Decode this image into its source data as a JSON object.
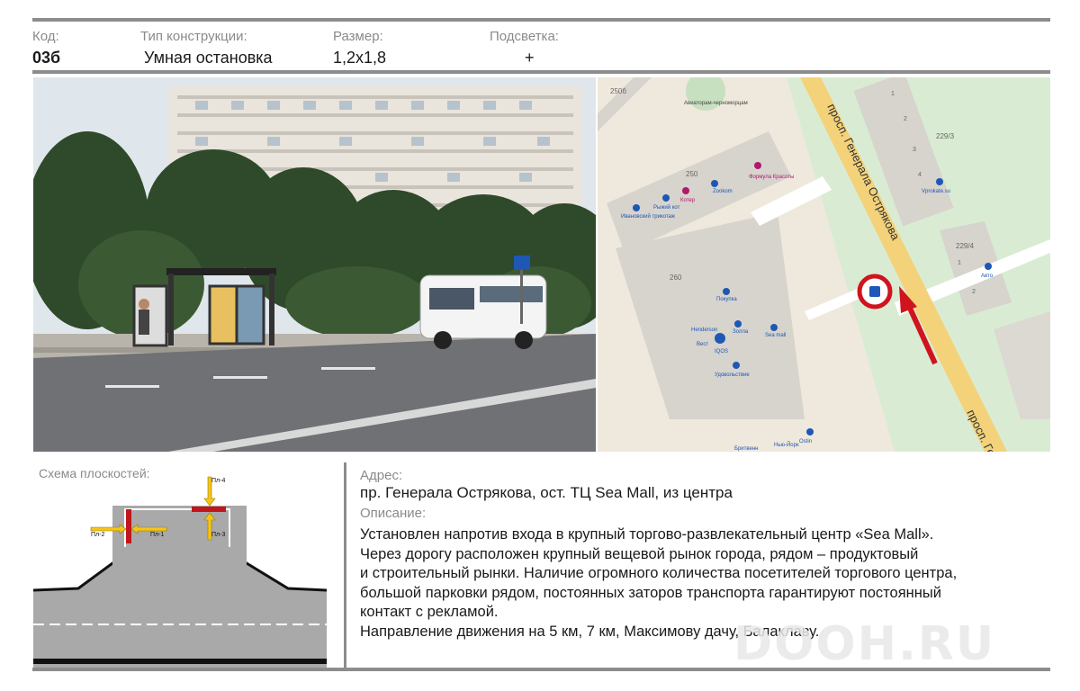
{
  "header": {
    "code_label": "Код:",
    "code_value": "03б",
    "type_label": "Тип конструкции:",
    "type_value": "Умная остановка",
    "size_label": "Размер:",
    "size_value": "1,2х1,8",
    "light_label": "Подсветка:",
    "light_value": "+"
  },
  "map": {
    "street_label": "просп. Генерала Острякова",
    "street_label_short": "просп. Гене",
    "numbers": [
      "250б",
      "250",
      "260",
      "229/3",
      "229/4",
      "1",
      "2",
      "3",
      "4",
      "1",
      "2"
    ],
    "places": [
      "Авиаторам-черноморцам",
      "Формула Красоты",
      "Zookom",
      "Котер",
      "Рыжий кот",
      "Ивановский трикотаж",
      "Vprokate.su",
      "Авто",
      "Покупка",
      "Henderson",
      "Золла",
      "Sea mall",
      "Вест",
      "IQOS",
      "Удовольствие",
      "Бритвенн",
      "Нью-Йорк",
      "Ostin"
    ]
  },
  "scheme": {
    "title": "Схема плоскостей:",
    "planes": [
      "Пл-1",
      "Пл-2",
      "Пл-3",
      "Пл-4"
    ]
  },
  "address": {
    "label": "Адрес:",
    "value": "пр. Генерала Острякова, ост. ТЦ Sea Mall, из центра"
  },
  "description": {
    "label": "Описание:",
    "line1": "Установлен напротив входа в крупный торгово-развлекательный центр «Sea Mall».",
    "line2": "Через дорогу расположен крупный вещевой рынок города, рядом – продуктовый",
    "line3": "и строительный рынки. Наличие огромного количества посетителей торгового центра,",
    "line4": "большой парковки рядом, постоянных заторов транспорта гарантируют постоянный",
    "line5": "контакт с рекламой.",
    "line6": "Направление движения на 5 км, 7 км, Максимову дачу, Балаклаву."
  },
  "watermark": "DOOH.RU",
  "colors": {
    "rule": "#8c8c8c",
    "marker": "#d0141e",
    "road": "#f3d27a",
    "plane": "#c0161c",
    "arrow": "#f5c518"
  }
}
